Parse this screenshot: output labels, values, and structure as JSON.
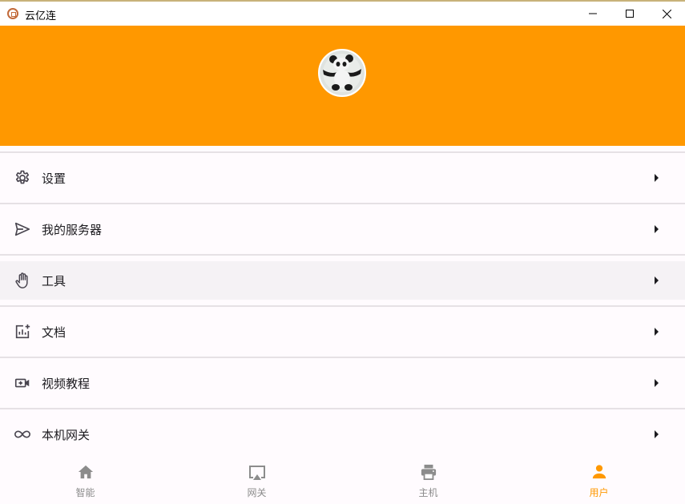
{
  "window": {
    "title": "云亿连",
    "icon": "app-logo-icon"
  },
  "header": {
    "background_color": "#ff9800",
    "avatar": "panda-avatar"
  },
  "menu": {
    "items": [
      {
        "label": "设置",
        "icon": "gear-icon"
      },
      {
        "label": "我的服务器",
        "icon": "send-icon"
      },
      {
        "label": "工具",
        "icon": "hand-icon"
      },
      {
        "label": "文档",
        "icon": "add-chart-icon"
      },
      {
        "label": "视频教程",
        "icon": "video-add-icon"
      },
      {
        "label": "本机网关",
        "icon": "infinity-icon"
      }
    ]
  },
  "bottom_nav": {
    "items": [
      {
        "label": "智能",
        "icon": "home-icon",
        "active": false
      },
      {
        "label": "网关",
        "icon": "airplay-icon",
        "active": false
      },
      {
        "label": "主机",
        "icon": "printer-icon",
        "active": false
      },
      {
        "label": "用户",
        "icon": "person-icon",
        "active": true
      }
    ],
    "active_color": "#ff9800",
    "inactive_color": "#8c8c8c"
  }
}
